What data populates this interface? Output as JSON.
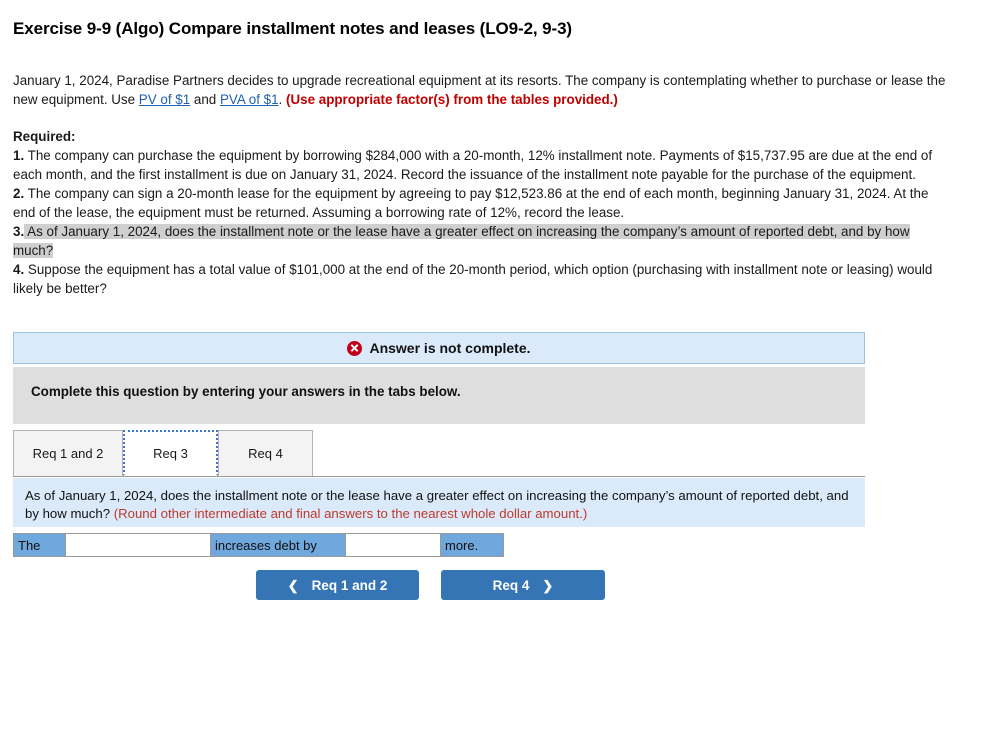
{
  "title": "Exercise 9-9 (Algo) Compare installment notes and leases (LO9-2, 9-3)",
  "intro": {
    "part1": "January 1, 2024, Paradise Partners decides to upgrade recreational equipment at its resorts. The company is contemplating whether to purchase or lease the new equipment. Use ",
    "link1": "PV of $1",
    "between": " and ",
    "link2": "PVA of $1",
    "period": ". ",
    "bold_note": "(Use appropriate factor(s) from the tables provided.)"
  },
  "required": {
    "label": "Required:",
    "items": [
      {
        "num": "1.",
        "text": " The company can purchase the equipment by borrowing $284,000 with a 20-month, 12% installment note. Payments of $15,737.95 are due at the end of each month, and the first installment is due on January 31, 2024. Record the issuance of the installment note payable for the purchase of the equipment."
      },
      {
        "num": "2.",
        "text": " The company can sign a 20-month lease for the equipment by agreeing to pay $12,523.86 at the end of each month, beginning January 31, 2024. At the end of the lease, the equipment must be returned. Assuming a borrowing rate of 12%, record the lease."
      },
      {
        "num": "3.",
        "text": " As of January 1, 2024, does the installment note or the lease have a greater effect on increasing the company’s amount of reported debt, and by how much?",
        "selected": true
      },
      {
        "num": "4.",
        "text": " Suppose the equipment has a total value of $101,000 at the end of the 20-month period, which option (purchasing with installment note or leasing) would likely be better?"
      }
    ]
  },
  "alert": {
    "icon": "error-x-icon",
    "text": "Answer is not complete.",
    "color": "#bf0019",
    "background": "#dbeafb"
  },
  "instruction": {
    "text": "Complete this question by entering your answers in the tabs below.",
    "background": "#dedede"
  },
  "tabs": [
    {
      "label": "Req 1 and 2",
      "active": false
    },
    {
      "label": "Req 3",
      "active": true
    },
    {
      "label": "Req 4",
      "active": false
    }
  ],
  "question": {
    "text": "As of January 1, 2024, does the installment note or the lease have a greater effect on increasing the company’s amount of reported debt, and by how much? ",
    "note": "(Round other intermediate and final answers to the nearest whole dollar amount.)",
    "note_color": "#c0392b",
    "background": "#dbeafb"
  },
  "answer_row": {
    "label_the": "The",
    "value_1": "",
    "placeholder_1": "",
    "label_increases": "increases debt by",
    "value_2": "",
    "placeholder_2": "",
    "label_more": "more.",
    "label_background": "#6fa8dd"
  },
  "nav": {
    "prev_label": "Req 1 and 2",
    "prev_icon": "chevron-left-icon",
    "next_label": "Req 4",
    "next_icon": "chevron-right-icon",
    "button_color": "#3575b5"
  }
}
